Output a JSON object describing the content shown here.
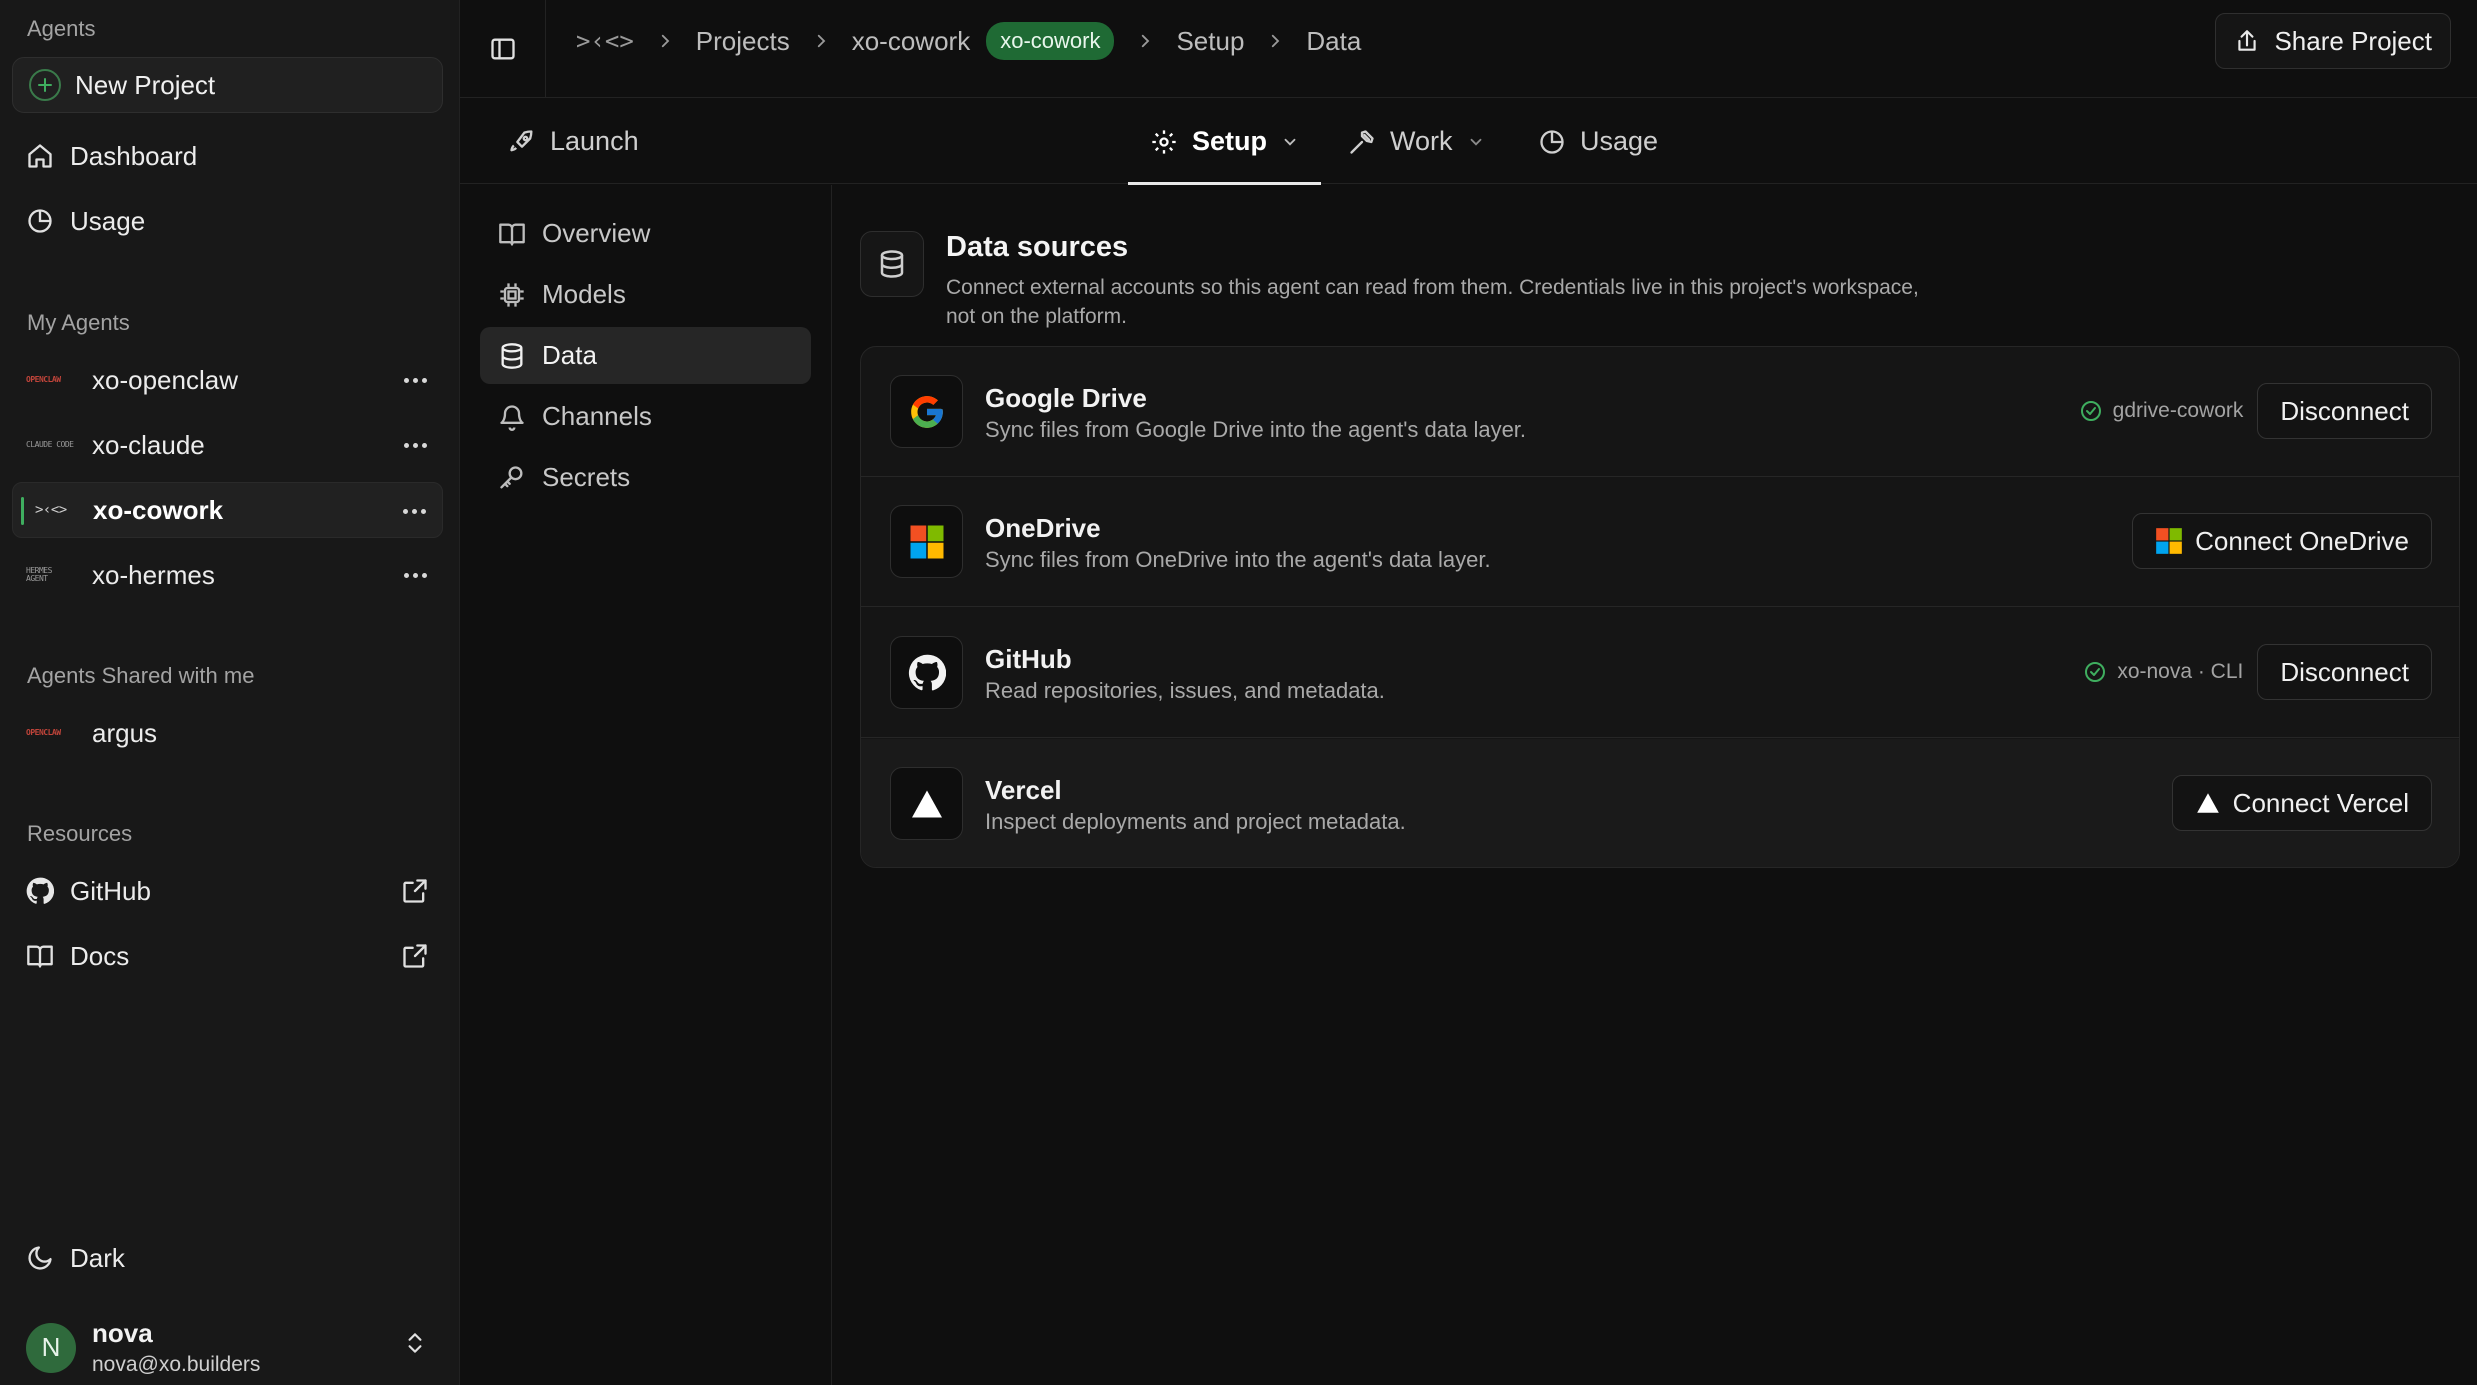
{
  "sidebar": {
    "agents_label": "Agents",
    "new_project": "New Project",
    "nav": [
      {
        "label": "Dashboard"
      },
      {
        "label": "Usage"
      }
    ],
    "my_agents_label": "My Agents",
    "my_agents": [
      {
        "name": "xo-openclaw",
        "logo": "OPENCLAW"
      },
      {
        "name": "xo-claude",
        "logo": "CLAUDE CODE"
      },
      {
        "name": "xo-cowork",
        "logo": ">‹<>"
      },
      {
        "name": "xo-hermes",
        "logo": "HERMES AGENT"
      }
    ],
    "shared_label": "Agents Shared with me",
    "shared_agents": [
      {
        "name": "argus",
        "logo": "OPENCLAW"
      }
    ],
    "resources_label": "Resources",
    "resources": [
      {
        "label": "GitHub"
      },
      {
        "label": "Docs"
      }
    ],
    "theme": "Dark",
    "user": {
      "initial": "N",
      "name": "nova",
      "email": "nova@xo.builders"
    }
  },
  "topbar": {
    "logo": ">‹<>",
    "crumbs": [
      "Projects",
      "xo-cowork",
      "Setup",
      "Data"
    ],
    "badge": "xo-cowork",
    "share": "Share Project"
  },
  "tabs": [
    {
      "label": "Launch"
    },
    {
      "label": "Setup"
    },
    {
      "label": "Work"
    },
    {
      "label": "Usage"
    }
  ],
  "subnav": [
    {
      "label": "Overview"
    },
    {
      "label": "Models"
    },
    {
      "label": "Data"
    },
    {
      "label": "Channels"
    },
    {
      "label": "Secrets"
    }
  ],
  "data_sources": {
    "title": "Data sources",
    "description": "Connect external accounts so this agent can read from them. Credentials live in this project's workspace, not on the platform.",
    "services": [
      {
        "name": "Google Drive",
        "desc": "Sync files from Google Drive into the agent's data layer.",
        "status": "gdrive-cowork",
        "action": "Disconnect"
      },
      {
        "name": "OneDrive",
        "desc": "Sync files from OneDrive into the agent's data layer.",
        "action": "Connect OneDrive"
      },
      {
        "name": "GitHub",
        "desc": "Read repositories, issues, and metadata.",
        "status": "xo-nova · CLI",
        "action": "Disconnect"
      },
      {
        "name": "Vercel",
        "desc": "Inspect deployments and project metadata.",
        "action": "Connect Vercel"
      }
    ]
  },
  "colors": {
    "accent": "#3fae5f",
    "badge_bg": "#1f6a34",
    "bg": "#0f0f0f",
    "sidebar_bg": "#181818"
  }
}
